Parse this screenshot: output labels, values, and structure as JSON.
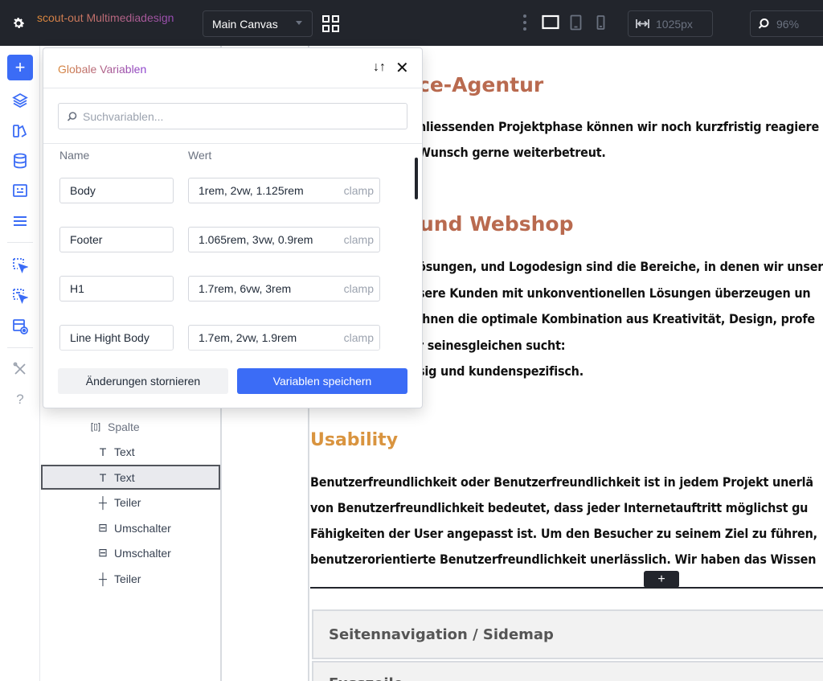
{
  "topbar": {
    "brand": "scout-out Multimediadesign",
    "canvas": "Main Canvas",
    "width_value": "1025px",
    "zoom_value": "96%"
  },
  "structure": {
    "items": [
      {
        "label": "Spalte",
        "icon": "column-icon"
      },
      {
        "label": "Text",
        "icon": "text-icon"
      },
      {
        "label": "Text",
        "icon": "text-icon",
        "selected": true
      },
      {
        "label": "Teiler",
        "icon": "divider-icon"
      },
      {
        "label": "Umschalter",
        "icon": "toggle-icon"
      },
      {
        "label": "Umschalter",
        "icon": "toggle-icon"
      },
      {
        "label": "Teiler",
        "icon": "divider-icon"
      }
    ]
  },
  "modal": {
    "title": "Globale Variablen",
    "search_placeholder": "Suchvariablen...",
    "col_name": "Name",
    "col_value": "Wert",
    "variables": [
      {
        "name": "Body",
        "value": "1rem, 2vw, 1.125rem",
        "unit": "clamp"
      },
      {
        "name": "Footer",
        "value": "1.065rem, 3vw, 0.9rem",
        "unit": "clamp"
      },
      {
        "name": "H1",
        "value": "1.7rem, 6vw, 3rem",
        "unit": "clamp"
      },
      {
        "name": "Line Hight Body",
        "value": "1.7em, 2vw, 1.9rem",
        "unit": "clamp"
      }
    ],
    "cancel_label": "Änderungen stornieren",
    "save_label": "Variablen speichern"
  },
  "page": {
    "heading1": "ce-Agentur",
    "para1": [
      "hliessenden Projektphase können wir noch kurzfristig reagiere",
      "Wunsch gerne weiterbetreut."
    ],
    "heading2": "und Webshop",
    "para2": [
      "ösungen, und Logodesign sind die Bereiche, in denen wir unser",
      "sere Kunden mit unkonventionellen Lösungen überzeugen un",
      "Ihnen die optimale Kombination aus Kreativität, Design, profe",
      "r seinesgleichen sucht:",
      "sig und kundenspezifisch."
    ],
    "heading3": "Usability",
    "para3": [
      "Benutzerfreundlichkeit oder Benutzerfreundlichkeit ist in jedem Projekt unerlä",
      "von Benutzerfreundlichkeit bedeutet, dass jeder Internetauftritt möglichst gu",
      "Fähigkeiten der User angepasst ist. Um den Besucher zu seinem Ziel zu führen,",
      "benutzerorientierte Benutzerfreundlichkeit unerlässlich. Wir haben das Wissen"
    ],
    "accordion1": "Seitennavigation / Sidemap",
    "accordion2": "Fusszeile"
  },
  "colors": {
    "accent": "#3b6cf6",
    "topbar": "#22252c",
    "heading": "#b96a4f",
    "usability_heading": "#d9943f"
  }
}
